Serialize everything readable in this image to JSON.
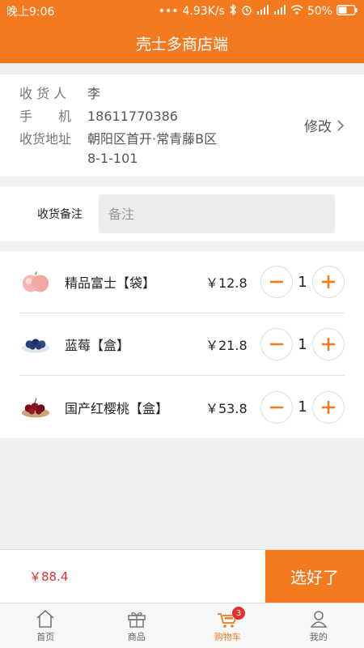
{
  "status_bar": {
    "time": "晚上9:06",
    "network_speed": "4.93K/s",
    "battery": "50%"
  },
  "header": {
    "title": "壳士多商店端"
  },
  "address": {
    "receiver_label": "收 货 人",
    "receiver_value": "李",
    "phone_label": "手　　机",
    "phone_value": "18611770386",
    "address_label": "收货地址",
    "address_line1": "朝阳区首开·常青藤B区",
    "address_line2": "8-1-101",
    "edit_label": "修改"
  },
  "remark": {
    "label": "收货备注",
    "placeholder": "备注"
  },
  "products": [
    {
      "name": "精品富士【袋】",
      "price": "￥12.8",
      "qty": "1",
      "icon": "apple-icon"
    },
    {
      "name": "蓝莓【盒】",
      "price": "￥21.8",
      "qty": "1",
      "icon": "blueberry-icon"
    },
    {
      "name": "国产红樱桃【盒】",
      "price": "￥53.8",
      "qty": "1",
      "icon": "cherry-icon"
    }
  ],
  "checkout": {
    "total": "￥88.4",
    "button_label": "选好了"
  },
  "tabs": [
    {
      "label": "首页",
      "icon": "home-icon"
    },
    {
      "label": "商品",
      "icon": "gift-icon"
    },
    {
      "label": "购物车",
      "icon": "cart-icon",
      "badge": "3",
      "active": true
    },
    {
      "label": "我的",
      "icon": "user-icon"
    }
  ],
  "colors": {
    "accent": "#f47a20",
    "price_red": "#e2312b"
  }
}
